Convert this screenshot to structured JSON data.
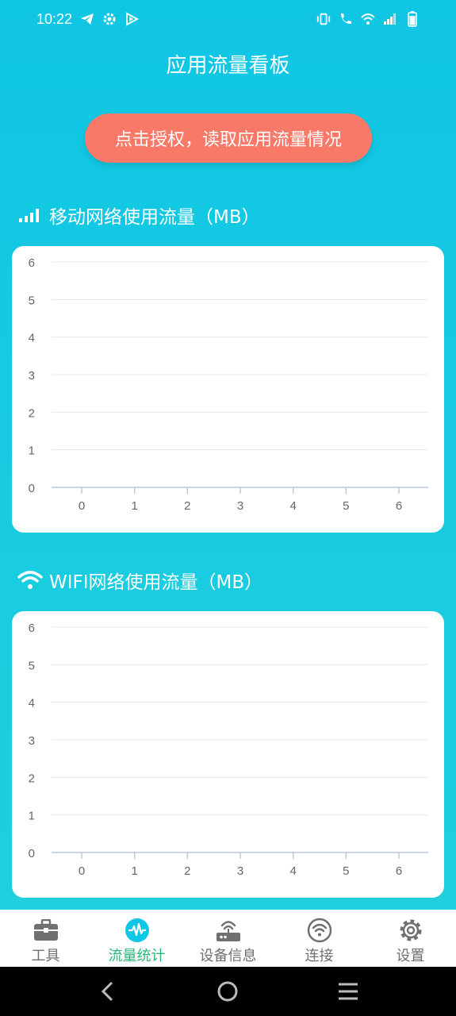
{
  "status_bar": {
    "time": "10:22",
    "left_icons": [
      "telegram-icon",
      "settings-gear-icon",
      "play-icon"
    ],
    "right_icons": [
      "vibrate-icon",
      "wifi-call-icon",
      "wifi-icon",
      "signal-icon",
      "battery-icon"
    ]
  },
  "page": {
    "title": "应用流量看板",
    "auth_button": "点击授权，读取应用流量情况"
  },
  "sections": {
    "mobile": {
      "title": "移动网络使用流量（MB）",
      "icon": "cellular-signal-icon"
    },
    "wifi": {
      "title": "WIFI网络使用流量（MB）",
      "icon": "wifi-icon"
    }
  },
  "chart_data": [
    {
      "type": "line",
      "title": "",
      "xlabel": "",
      "ylabel": "",
      "x_ticks": [
        "0",
        "1",
        "2",
        "3",
        "4",
        "5",
        "6"
      ],
      "y_ticks": [
        "0",
        "1",
        "2",
        "3",
        "4",
        "5",
        "6"
      ],
      "xlim": [
        0,
        6
      ],
      "ylim": [
        0,
        6
      ],
      "series": [],
      "grid": "horizontal"
    },
    {
      "type": "line",
      "title": "",
      "xlabel": "",
      "ylabel": "",
      "x_ticks": [
        "0",
        "1",
        "2",
        "3",
        "4",
        "5",
        "6"
      ],
      "y_ticks": [
        "0",
        "1",
        "2",
        "3",
        "4",
        "5",
        "6"
      ],
      "xlim": [
        0,
        6
      ],
      "ylim": [
        0,
        6
      ],
      "series": [],
      "grid": "horizontal"
    }
  ],
  "tabs": [
    {
      "label": "工具",
      "icon": "toolbox-icon",
      "active": false
    },
    {
      "label": "流量统计",
      "icon": "pulse-icon",
      "active": true
    },
    {
      "label": "设备信息",
      "icon": "router-icon",
      "active": false
    },
    {
      "label": "连接",
      "icon": "wifi-circle-icon",
      "active": false
    },
    {
      "label": "设置",
      "icon": "gear-icon",
      "active": false
    }
  ],
  "colors": {
    "accent": "#2bb678",
    "button": "#f97969",
    "background_top": "#0fc6e4",
    "background_bottom": "#22d0de"
  }
}
